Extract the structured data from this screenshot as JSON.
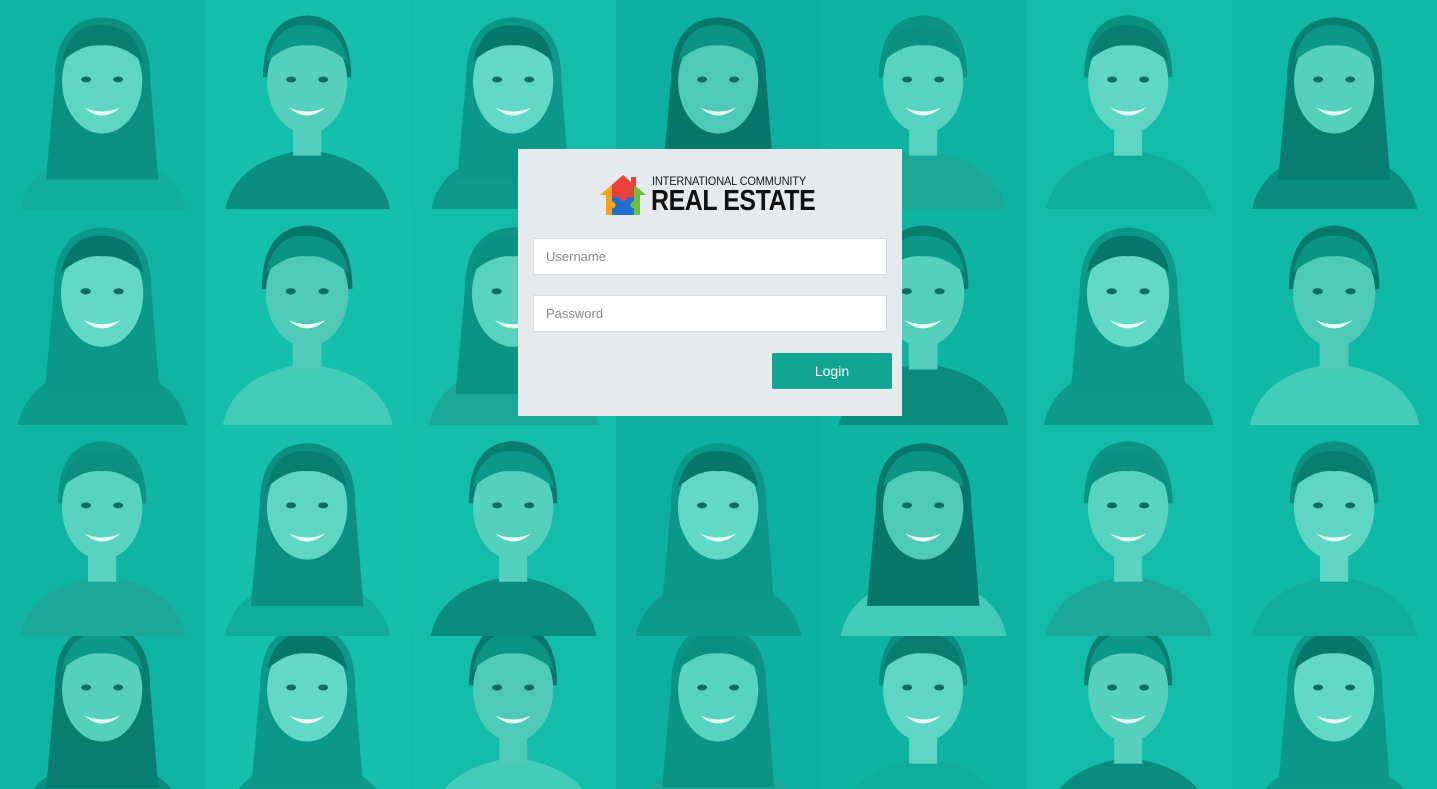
{
  "brand": {
    "top_line": "INTERNATIONAL COMMUNITY",
    "main_line": "REAL ESTATE",
    "logo_icon": "puzzle-house-icon"
  },
  "login": {
    "username_placeholder": "Username",
    "password_placeholder": "Password",
    "username_value": "",
    "password_value": "",
    "submit_label": "Login"
  },
  "background": {
    "description_icon": "people-portrait-grid",
    "tint_color": "#10b8a4"
  },
  "colors": {
    "card_background": "#e7eaed",
    "button_color": "#12a592",
    "button_text": "#ffffff"
  }
}
